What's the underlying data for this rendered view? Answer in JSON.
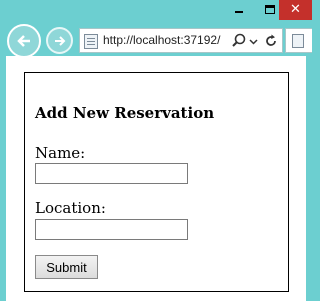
{
  "browser": {
    "address": "http://localhost:37192/",
    "window_buttons": {
      "close_glyph": "✕"
    }
  },
  "form": {
    "title": "Add New Reservation",
    "name_label": "Name:",
    "name_value": "",
    "location_label": "Location:",
    "location_value": "",
    "submit_label": "Submit"
  }
}
